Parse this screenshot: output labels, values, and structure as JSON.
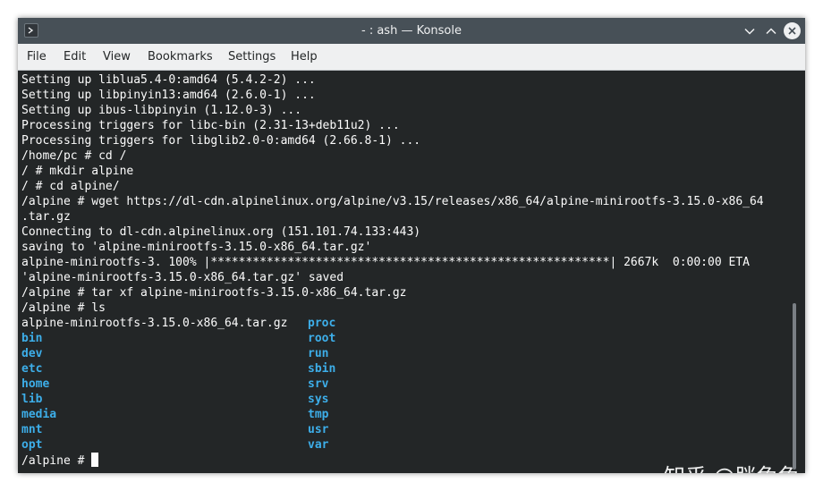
{
  "window": {
    "title": "- : ash — Konsole"
  },
  "menubar": {
    "items": [
      "File",
      "Edit",
      "View",
      "Bookmarks",
      "Settings",
      "Help"
    ]
  },
  "terminal": {
    "lines": [
      "Setting up liblua5.4-0:amd64 (5.4.2-2) ...",
      "Setting up libpinyin13:amd64 (2.6.0-1) ...",
      "Setting up ibus-libpinyin (1.12.0-3) ...",
      "Processing triggers for libc-bin (2.31-13+deb11u2) ...",
      "Processing triggers for libglib2.0-0:amd64 (2.66.8-1) ...",
      "/home/pc # cd /",
      "/ # mkdir alpine",
      "/ # cd alpine/",
      "/alpine # wget https://dl-cdn.alpinelinux.org/alpine/v3.15/releases/x86_64/alpine-minirootfs-3.15.0-x86_64",
      ".tar.gz",
      "Connecting to dl-cdn.alpinelinux.org (151.101.74.133:443)",
      "saving to 'alpine-minirootfs-3.15.0-x86_64.tar.gz'",
      "alpine-minirootfs-3. 100% |*********************************************************| 2667k  0:00:00 ETA",
      "'alpine-minirootfs-3.15.0-x86_64.tar.gz' saved",
      "/alpine # tar xf alpine-minirootfs-3.15.0-x86_64.tar.gz",
      "/alpine # ls"
    ],
    "ls_rows": [
      [
        "alpine-minirootfs-3.15.0-x86_64.tar.gz",
        "proc"
      ],
      [
        "bin",
        "root"
      ],
      [
        "dev",
        "run"
      ],
      [
        "etc",
        "sbin"
      ],
      [
        "home",
        "srv"
      ],
      [
        "lib",
        "sys"
      ],
      [
        "media",
        "tmp"
      ],
      [
        "mnt",
        "usr"
      ],
      [
        "opt",
        "var"
      ]
    ],
    "prompt": "/alpine # "
  },
  "watermark": "知乎 @胖兔兔",
  "colors": {
    "titlebar": "#475057",
    "menubar": "#eff0f1",
    "terminal_bg": "#232627",
    "terminal_fg": "#fcfcfc",
    "directory": "#3daee9"
  },
  "icons": {
    "app": "konsole-icon",
    "minimize": "chevron-down-icon",
    "maximize": "chevron-up-icon",
    "close": "close-icon"
  }
}
